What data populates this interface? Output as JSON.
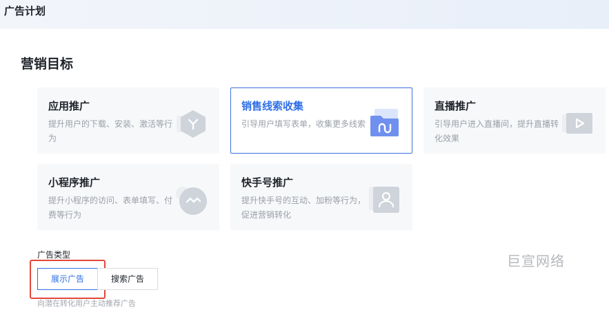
{
  "header": {
    "title": "广告计划"
  },
  "section": {
    "title": "营销目标"
  },
  "cards": [
    {
      "title": "应用推广",
      "desc": "提升用户的下载、安装、激活等行为",
      "icon": "app-hexagon-icon",
      "selected": false
    },
    {
      "title": "销售线索收集",
      "desc": "引导用户填写表单，收集更多线索",
      "icon": "folder-lead-icon",
      "selected": true
    },
    {
      "title": "直播推广",
      "desc": "引导用户进入直播间，提升直播转化效果",
      "icon": "play-video-icon",
      "selected": false
    },
    {
      "title": "小程序推广",
      "desc": "提升小程序的访问、表单填写、付费等行为",
      "icon": "mini-program-icon",
      "selected": false
    },
    {
      "title": "快手号推广",
      "desc": "提升快手号的互动、加粉等行为，促进营销转化",
      "icon": "user-account-icon",
      "selected": false
    }
  ],
  "ad_type": {
    "label": "广告类型",
    "options": [
      "展示广告",
      "搜索广告"
    ],
    "selected": "展示广告",
    "hint": "向潜在转化用户主动推荐广告"
  },
  "watermark": "巨宣网络",
  "colors": {
    "accent": "#2f6ee6",
    "highlight_box": "#e2463a",
    "card_bg": "#f7f8fa"
  }
}
